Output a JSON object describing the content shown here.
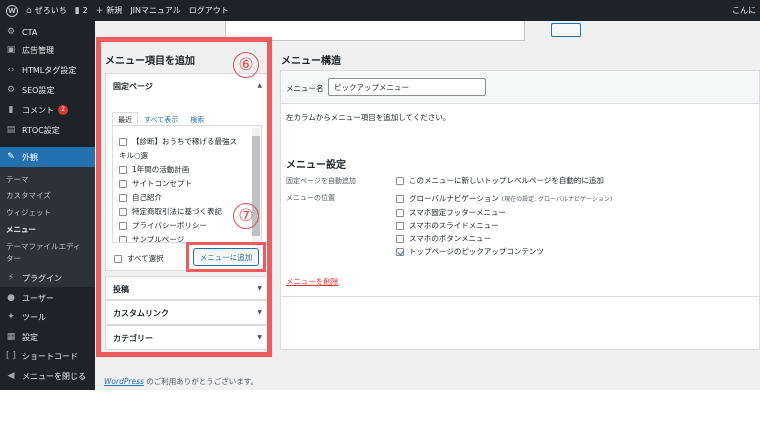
{
  "admin_bar": {
    "site_name": "ぜろいち",
    "comments_count": "2",
    "new_label": "新規",
    "manual_label": "JINマニュアル",
    "logout_label": "ログアウト",
    "greeting": "こんに"
  },
  "sidebar": {
    "items": [
      {
        "label": "CTA",
        "icon": "gear-icon"
      },
      {
        "label": "広告管理",
        "icon": "ad-icon"
      },
      {
        "label": "HTMLタグ設定",
        "icon": "code-icon"
      },
      {
        "label": "SEO設定",
        "icon": "gear-icon"
      },
      {
        "label": "コメント",
        "icon": "comment-icon",
        "badge": "2"
      },
      {
        "label": "RTOC設定",
        "icon": "grid-icon"
      },
      {
        "label": "外観",
        "icon": "brush-icon"
      },
      {
        "label": "プラグイン",
        "icon": "plugin-icon"
      },
      {
        "label": "ユーザー",
        "icon": "user-icon"
      },
      {
        "label": "ツール",
        "icon": "wrench-icon"
      },
      {
        "label": "設定",
        "icon": "settings-icon"
      },
      {
        "label": "ショートコード",
        "icon": "bracket-icon"
      },
      {
        "label": "メニューを閉じる",
        "icon": "collapse-icon"
      }
    ],
    "submenu": [
      "テーマ",
      "カスタマイズ",
      "ウィジェット",
      "メニュー",
      "テーマファイルエディ",
      "ター"
    ]
  },
  "left": {
    "title": "メニュー項目を追加",
    "fixed_pages_title": "固定ページ",
    "tabs": [
      "最近",
      "すべて表示",
      "検索"
    ],
    "pages": [
      "【診断】おうちで稼げる最強ス",
      "キル○選",
      "1年間の活動計画",
      "サイトコンセプト",
      "自己紹介",
      "特定商取引法に基づく表記",
      "プライバシーポリシー",
      "サンプルページ"
    ],
    "select_all": "すべて選択",
    "add_button": "メニューに追加",
    "panels": [
      "投稿",
      "カスタムリンク",
      "カテゴリー"
    ]
  },
  "annotations": {
    "step6": "⑥",
    "step7": "⑦"
  },
  "right": {
    "title": "メニュー構造",
    "menu_name_label": "メニュー名",
    "menu_name_value": "ピックアップメニュー",
    "hint": "左カラムからメニュー項目を追加してください。",
    "settings_title": "メニュー設定",
    "auto_add_label": "固定ページを自動追加",
    "auto_add_option": "このメニューに新しいトップレベルページを自動的に追加",
    "location_label": "メニューの位置",
    "locations": [
      {
        "label": "グローバルナビゲーション",
        "note": "(現在の設定: グローバルナビゲーション)",
        "checked": false
      },
      {
        "label": "スマホ固定フッターメニュー",
        "note": "",
        "checked": false
      },
      {
        "label": "スマホのスライドメニュー",
        "note": "",
        "checked": false
      },
      {
        "label": "スマホのボタンメニュー",
        "note": "",
        "checked": false
      },
      {
        "label": "トップページのピックアップコンテンツ",
        "note": "",
        "checked": true
      }
    ],
    "delete_link": "メニューを削除"
  },
  "footer": {
    "wp_link": "WordPress",
    "thanks": " のご利用ありがとうございます。"
  },
  "colors": {
    "highlight": "#f15b5b",
    "admin_dark": "#1d2327",
    "accent": "#2271b1"
  }
}
